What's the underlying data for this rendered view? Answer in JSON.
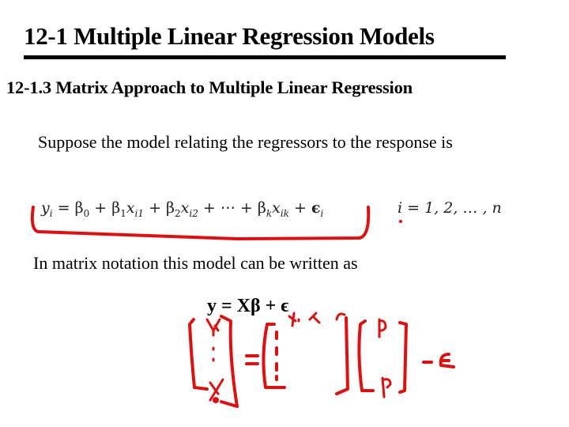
{
  "slide": {
    "title": "12-1 Multiple Linear Regression Models",
    "subtitle": "12-1.3 Matrix Approach to Multiple Linear Regression",
    "paragraph1": "Suppose the model relating the regressors to the response is",
    "equation": {
      "lhs": "y",
      "lhs_sub": "i",
      "eq": " = ",
      "terms": [
        {
          "coef": "β",
          "coef_sub": "0",
          "var": "",
          "var_sub": ""
        },
        {
          "coef": "β",
          "coef_sub": "1",
          "var": "x",
          "var_sub": "i1"
        },
        {
          "coef": "β",
          "coef_sub": "2",
          "var": "x",
          "var_sub": "i2"
        },
        {
          "coef": "",
          "coef_sub": "",
          "var": "⋯",
          "var_sub": ""
        },
        {
          "coef": "β",
          "coef_sub": "k",
          "var": "x",
          "var_sub": "ik"
        }
      ],
      "plus": " + ",
      "error": "ϵ",
      "error_sub": "i"
    },
    "index_range": "i = 1, 2, … , n",
    "paragraph2": "In matrix notation this model can be written as",
    "matrix_equation": "y = Xβ + ϵ",
    "annotations": {
      "ink_color": "#dd1111",
      "handwritten_labels": [
        "y1",
        "yn",
        "x1",
        "x2",
        "βo",
        "βk",
        "+ ε",
        "="
      ]
    }
  }
}
